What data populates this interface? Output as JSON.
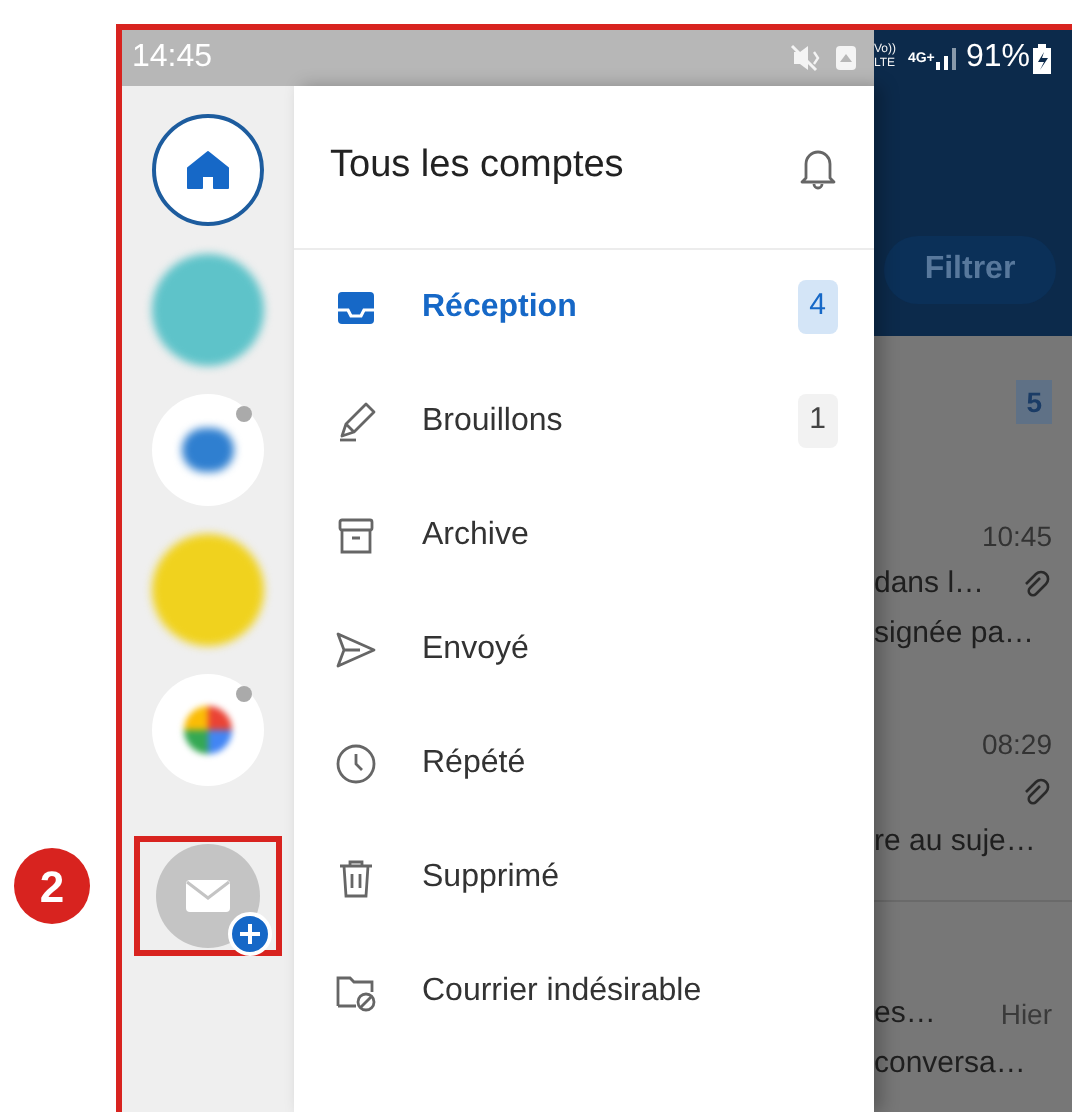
{
  "annotation": {
    "label": "2"
  },
  "status_bar": {
    "time": "14:45",
    "volte_top": "Vo))",
    "volte_bottom": "LTE",
    "network": "4G+",
    "battery": "91%"
  },
  "accounts": [
    {
      "kind": "home",
      "selected": true
    },
    {
      "kind": "avatar",
      "color": "#5ec3c9",
      "selected": false
    },
    {
      "kind": "logo",
      "color": "#2f7fd0",
      "badge": true,
      "selected": false
    },
    {
      "kind": "avatar",
      "color": "#f0d21e",
      "selected": false
    },
    {
      "kind": "google",
      "badge": true,
      "selected": false
    },
    {
      "kind": "add",
      "highlighted": true
    }
  ],
  "drawer": {
    "title": "Tous les comptes",
    "folders": [
      {
        "kind": "inbox",
        "label": "Réception",
        "count": "4",
        "selected": true
      },
      {
        "kind": "drafts",
        "label": "Brouillons",
        "count": "1",
        "selected": false
      },
      {
        "kind": "archive",
        "label": "Archive",
        "selected": false
      },
      {
        "kind": "sent",
        "label": "Envoyé",
        "selected": false
      },
      {
        "kind": "snoozed",
        "label": "Répété",
        "selected": false
      },
      {
        "kind": "deleted",
        "label": "Supprimé",
        "selected": false
      },
      {
        "kind": "junk",
        "label": "Courrier indésirable",
        "selected": false
      }
    ]
  },
  "background_list": {
    "filter_button": "Filtrer",
    "unread_count": "5",
    "messages": [
      {
        "time": "10:45",
        "line_1": "dans l…",
        "attachment": true,
        "line_2": "signée pa…"
      },
      {
        "time": "08:29",
        "attachment": true,
        "line_2": "re au suje…"
      },
      {
        "time": "Hier",
        "line_1": "es…",
        "attachment": false,
        "line_2": "conversa…"
      }
    ]
  }
}
